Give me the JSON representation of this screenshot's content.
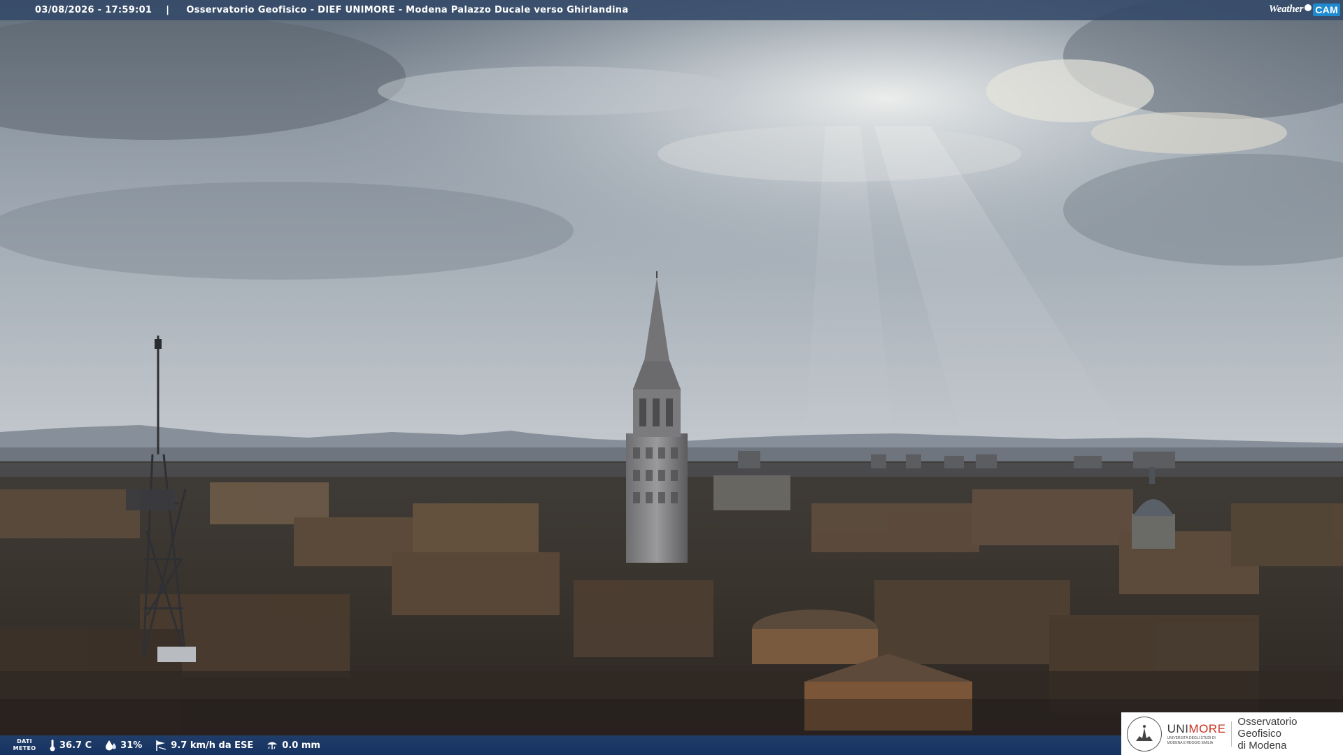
{
  "header": {
    "datetime": "03/08/2026 - 17:59:01",
    "separator": "|",
    "location": "Osservatorio Geofisico - DIEF UNIMORE - Modena Palazzo Ducale verso Ghirlandina"
  },
  "brand": {
    "weather_text": "Weather",
    "cam_text": "CAM"
  },
  "weather_bar": {
    "label_line1": "DATI",
    "label_line2": "METEO",
    "temperature": "36.7 C",
    "humidity": "31%",
    "wind": "9.7 km/h da ESE",
    "rain": "0.0 mm",
    "icons": [
      "thermometer-icon",
      "humidity-drop-icon",
      "wind-icon",
      "rain-gauge-icon"
    ]
  },
  "logo": {
    "university_prefix": "UNI",
    "university_accent": "MORE",
    "university_subtitle_line1": "UNIVERSITÀ DEGLI STUDI DI",
    "university_subtitle_line2": "MODENA E REGGIO EMILIA",
    "observatory_line1": "Osservatorio Geofisico",
    "observatory_line2": "di Modena",
    "accent_color": "#c8321e"
  },
  "colors": {
    "top_bar": "#324868",
    "bottom_bar": "#1e4682",
    "cam_badge": "#1f8ad0"
  }
}
